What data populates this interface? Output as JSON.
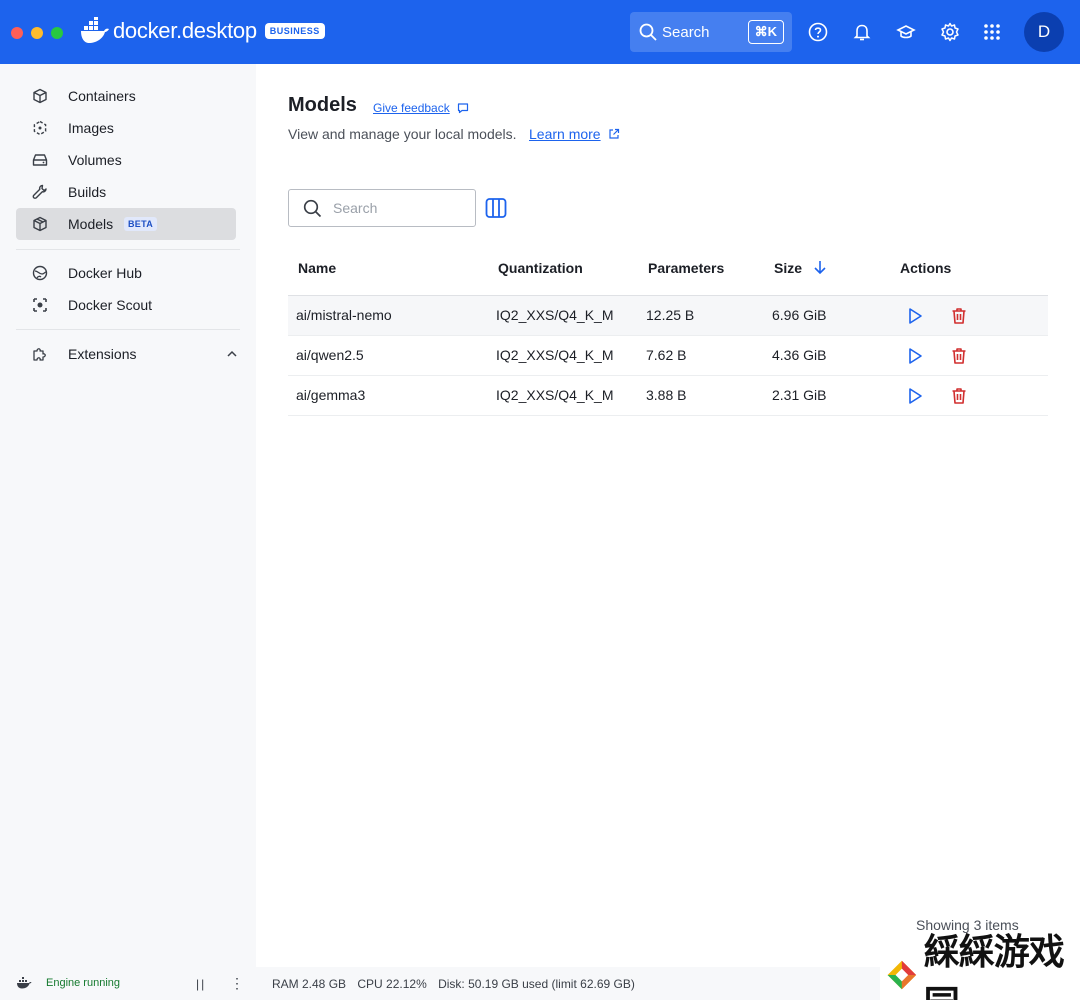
{
  "app": {
    "brand": "docker.desktop",
    "badge": "BUSINESS",
    "colors": {
      "brand_blue": "#1d63ed",
      "danger_red": "#d12f2f",
      "running_green": "#157a2e"
    }
  },
  "topbar": {
    "search_label": "Search",
    "shortcut": "⌘K",
    "avatar_initial": "D",
    "icons": [
      "help-icon",
      "bell-icon",
      "learn-cap-icon",
      "gear-icon",
      "apps-grid-icon"
    ]
  },
  "sidebar": {
    "items": [
      {
        "label": "Containers",
        "icon": "container-icon"
      },
      {
        "label": "Images",
        "icon": "images-icon"
      },
      {
        "label": "Volumes",
        "icon": "volume-icon"
      },
      {
        "label": "Builds",
        "icon": "wrench-icon"
      },
      {
        "label": "Models",
        "icon": "model-cube-icon",
        "badge": "BETA",
        "active": true
      },
      {
        "label": "Docker Hub",
        "icon": "hub-icon"
      },
      {
        "label": "Docker Scout",
        "icon": "scout-icon"
      },
      {
        "label": "Extensions",
        "icon": "puzzle-icon"
      }
    ]
  },
  "main": {
    "title": "Models",
    "feedback": "Give feedback",
    "subtitle": "View and manage your local models.",
    "learn_more": "Learn more",
    "search_placeholder": "Search",
    "columns": [
      "Name",
      "Quantization",
      "Parameters",
      "Size",
      "Actions"
    ],
    "rows": [
      {
        "name": "ai/mistral-nemo",
        "quantization": "IQ2_XXS/Q4_K_M",
        "parameters": "12.25 B",
        "size": "6.96 GiB"
      },
      {
        "name": "ai/qwen2.5",
        "quantization": "IQ2_XXS/Q4_K_M",
        "parameters": "7.62 B",
        "size": "4.36 GiB"
      },
      {
        "name": "ai/gemma3",
        "quantization": "IQ2_XXS/Q4_K_M",
        "parameters": "3.88 B",
        "size": "2.31 GiB"
      }
    ],
    "showing": "Showing 3 items"
  },
  "statusbar": {
    "engine": "Engine running",
    "ram": "RAM 2.48 GB",
    "cpu": "CPU 22.12%",
    "disk": "Disk: 50.19 GB used (limit 62.69 GB)"
  },
  "watermark": {
    "text": "綵綵游戏园"
  }
}
